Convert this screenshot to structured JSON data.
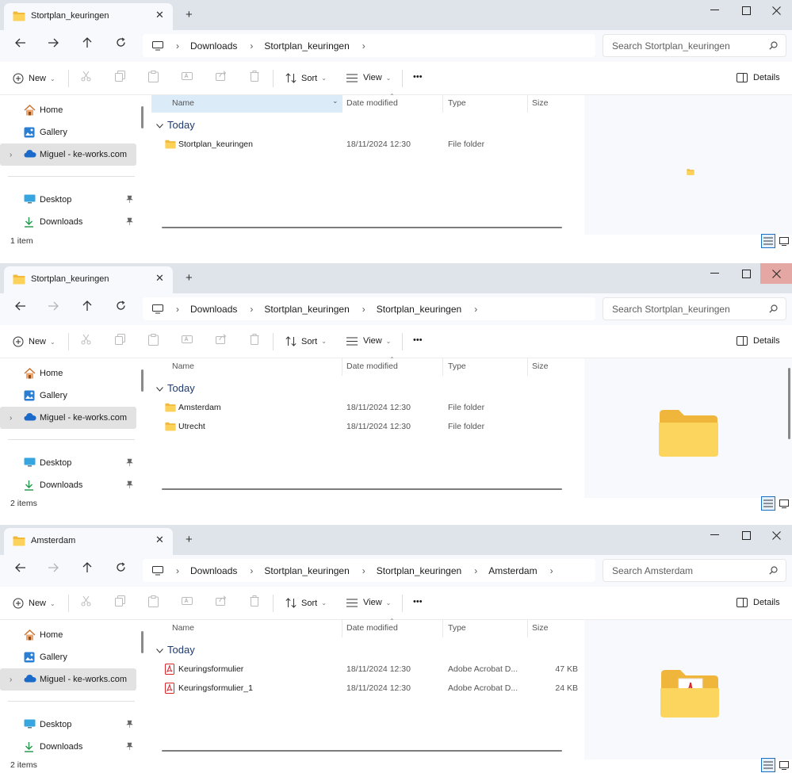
{
  "windows": [
    {
      "tab_title": "Stortplan_keuringen",
      "breadcrumbs": [
        "Downloads",
        "Stortplan_keuringen"
      ],
      "search_placeholder": "Search Stortplan_keuringen",
      "group": "Today",
      "rows": [
        {
          "name": "Stortplan_keuringen",
          "date": "18/11/2024 12:30",
          "type": "File folder",
          "size": "",
          "icon": "folder-icon"
        }
      ],
      "status": "1 item"
    },
    {
      "tab_title": "Stortplan_keuringen",
      "breadcrumbs": [
        "Downloads",
        "Stortplan_keuringen",
        "Stortplan_keuringen"
      ],
      "search_placeholder": "Search Stortplan_keuringen",
      "group": "Today",
      "rows": [
        {
          "name": "Amsterdam",
          "date": "18/11/2024 12:30",
          "type": "File folder",
          "size": "",
          "icon": "folder-icon"
        },
        {
          "name": "Utrecht",
          "date": "18/11/2024 12:30",
          "type": "File folder",
          "size": "",
          "icon": "folder-icon"
        }
      ],
      "status": "2 items"
    },
    {
      "tab_title": "Amsterdam",
      "breadcrumbs": [
        "Downloads",
        "Stortplan_keuringen",
        "Stortplan_keuringen",
        "Amsterdam"
      ],
      "search_placeholder": "Search Amsterdam",
      "group": "Today",
      "rows": [
        {
          "name": "Keuringsformulier",
          "date": "18/11/2024 12:30",
          "type": "Adobe Acrobat D...",
          "size": "47 KB",
          "icon": "pdf-icon"
        },
        {
          "name": "Keuringsformulier_1",
          "date": "18/11/2024 12:30",
          "type": "Adobe Acrobat D...",
          "size": "24 KB",
          "icon": "pdf-icon"
        }
      ],
      "status": "2 items"
    }
  ],
  "toolbar": {
    "new": "New",
    "sort": "Sort",
    "view": "View",
    "more": "•••",
    "details": "Details"
  },
  "columns": {
    "name": "Name",
    "date": "Date modified",
    "type": "Type",
    "size": "Size"
  },
  "sidebar": {
    "items": [
      {
        "label": "Home",
        "icon": "home-icon"
      },
      {
        "label": "Gallery",
        "icon": "gallery-icon"
      },
      {
        "label": "Miguel - ke-works.com",
        "icon": "onedrive-cloud-icon"
      },
      {
        "label": "Desktop",
        "icon": "desktop-icon"
      },
      {
        "label": "Downloads",
        "icon": "downloads-icon"
      }
    ]
  },
  "colors": {
    "folder": "#f6c744",
    "accent": "#1a6fc4",
    "pdf": "#d8282c",
    "titlebar": "#dfe4ea"
  }
}
